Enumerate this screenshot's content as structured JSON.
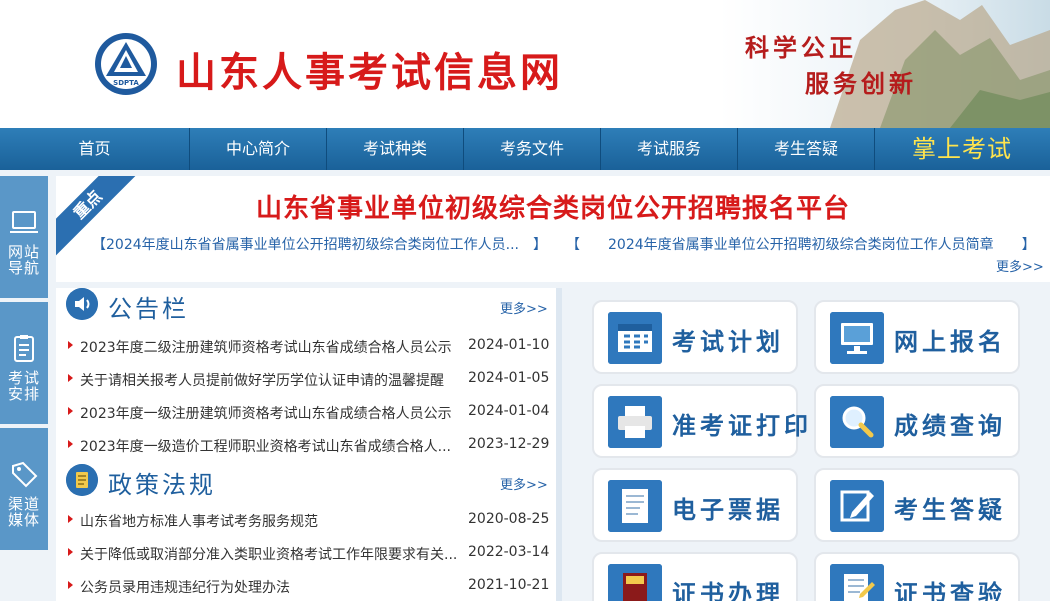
{
  "header": {
    "site_title": "山东人事考试信息网",
    "logo_text": "SDPTA",
    "slogan_line1": "科学公正",
    "slogan_line2": "服务创新"
  },
  "nav": {
    "items": [
      "首页",
      "中心简介",
      "考试种类",
      "考务文件",
      "考试服务",
      "考生答疑"
    ],
    "mobile": "掌上考试"
  },
  "sidebar": {
    "items": [
      {
        "label": "网站导航",
        "icon": "laptop-icon"
      },
      {
        "label": "考试安排",
        "icon": "clipboard-icon"
      },
      {
        "label": "渠道媒体",
        "icon": "tag-icon"
      }
    ]
  },
  "highlight": {
    "badge": "重点",
    "title": "山东省事业单位初级综合类岗位公开招聘报名平台",
    "links": [
      "【2024年度山东省省属事业单位公开招聘初级综合类岗位工作人员...　】",
      "【　　2024年度省属事业单位公开招聘初级综合类岗位工作人员简章　　】"
    ],
    "more": "更多>>"
  },
  "notice": {
    "title": "公告栏",
    "more": "更多>>",
    "rows": [
      {
        "text": "2023年度二级注册建筑师资格考试山东省成绩合格人员公示",
        "date": "2024-01-10"
      },
      {
        "text": "关于请相关报考人员提前做好学历学位认证申请的温馨提醒",
        "date": "2024-01-05"
      },
      {
        "text": "2023年度一级注册建筑师资格考试山东省成绩合格人员公示",
        "date": "2024-01-04"
      },
      {
        "text": "2023年度一级造价工程师职业资格考试山东省成绩合格人...",
        "date": "2023-12-29"
      }
    ]
  },
  "policy": {
    "title": "政策法规",
    "more": "更多>>",
    "rows": [
      {
        "text": "山东省地方标准人事考试考务服务规范",
        "date": "2020-08-25"
      },
      {
        "text": "关于降低或取消部分准入类职业资格考试工作年限要求有关...",
        "date": "2022-03-14"
      },
      {
        "text": "公务员录用违规违纪行为处理办法",
        "date": "2021-10-21"
      }
    ]
  },
  "services": [
    {
      "label": "考试计划",
      "icon": "calendar-icon"
    },
    {
      "label": "网上报名",
      "icon": "monitor-icon"
    },
    {
      "label": "准考证打印",
      "icon": "printer-icon"
    },
    {
      "label": "成绩查询",
      "icon": "magnifier-icon"
    },
    {
      "label": "电子票据",
      "icon": "document-icon"
    },
    {
      "label": "考生答疑",
      "icon": "edit-icon"
    },
    {
      "label": "证书办理",
      "icon": "book-icon"
    },
    {
      "label": "证书查验",
      "icon": "certificate-icon"
    }
  ],
  "colors": {
    "brand_red": "#d71a1a",
    "nav_blue": "#1a6199",
    "accent_blue": "#2b6fb1",
    "mobile_yellow": "#ffe44d"
  }
}
